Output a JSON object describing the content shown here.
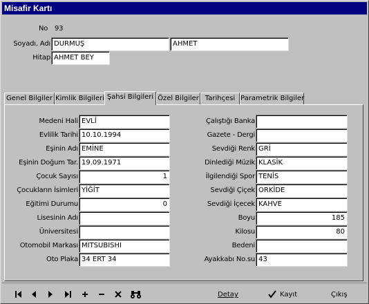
{
  "window": {
    "title": "Misafir Kartı"
  },
  "header": {
    "no_label": "No",
    "no_value": "93",
    "soyadi_adi_label": "Soyadı, Adı",
    "soyadi_value": "DURMUŞ",
    "adi_value": "AHMET",
    "hitap_label": "Hitap",
    "hitap_value": "AHMET BEY"
  },
  "tabs": [
    {
      "label": "Genel Bilgiler"
    },
    {
      "label": "Kimlik Bilgileri"
    },
    {
      "label": "Şahsi Bilgileri"
    },
    {
      "label": "Özel Bilgiler"
    },
    {
      "label": "Tarihçesi"
    },
    {
      "label": "Parametrik Bilgiler"
    }
  ],
  "left_fields": [
    {
      "label": "Medeni Hali",
      "value": "EVLİ"
    },
    {
      "label": "Evlilik Tarihi",
      "value": "10.10.1994"
    },
    {
      "label": "Eşinin Adı",
      "value": "EMİNE"
    },
    {
      "label": "Eşinin Doğum Tar.",
      "value": "19.09.1971"
    },
    {
      "label": "Çocuk Sayısı",
      "value": "1"
    },
    {
      "label": "Çocukların İsimleri",
      "value": "YİĞİT"
    },
    {
      "label": "Eğitimi Durumu",
      "value": "0"
    },
    {
      "label": "Lisesinin Adı",
      "value": ""
    },
    {
      "label": "Üniversitesi",
      "value": ""
    },
    {
      "label": "Otomobil Markası",
      "value": "MITSUBISHI"
    },
    {
      "label": "Oto Plaka",
      "value": "34 ERT 34"
    }
  ],
  "right_fields": [
    {
      "label": "Çalıştığı Banka",
      "value": ""
    },
    {
      "label": "Gazete - Dergi",
      "value": ""
    },
    {
      "label": "Sevdiği Renk",
      "value": "GRİ"
    },
    {
      "label": "Dinlediği Müzik",
      "value": "KLASİK"
    },
    {
      "label": "İlgilendiği Spor",
      "value": "TENİS"
    },
    {
      "label": "Sevdiği Çiçek",
      "value": "ORKİDE"
    },
    {
      "label": "Sevdiği İçecek",
      "value": "KAHVE"
    },
    {
      "label": "Boyu",
      "value": "185"
    },
    {
      "label": "Kilosu",
      "value": "80"
    },
    {
      "label": "Bedeni",
      "value": ""
    },
    {
      "label": "Ayakkabı No.su",
      "value": "43"
    }
  ],
  "toolbar": {
    "icons": [
      "first-record-icon",
      "prior-record-icon",
      "next-record-icon",
      "last-record-icon",
      "add-icon",
      "delete-icon",
      "cancel-icon",
      "search-binoculars-icon"
    ],
    "detay_label": "Detay",
    "kayit_label": "Kayıt",
    "cikis_label": "Çıkış"
  },
  "colors": {
    "titlebar": "#000080",
    "face": "#c0c0c0",
    "field": "#ffffff"
  }
}
